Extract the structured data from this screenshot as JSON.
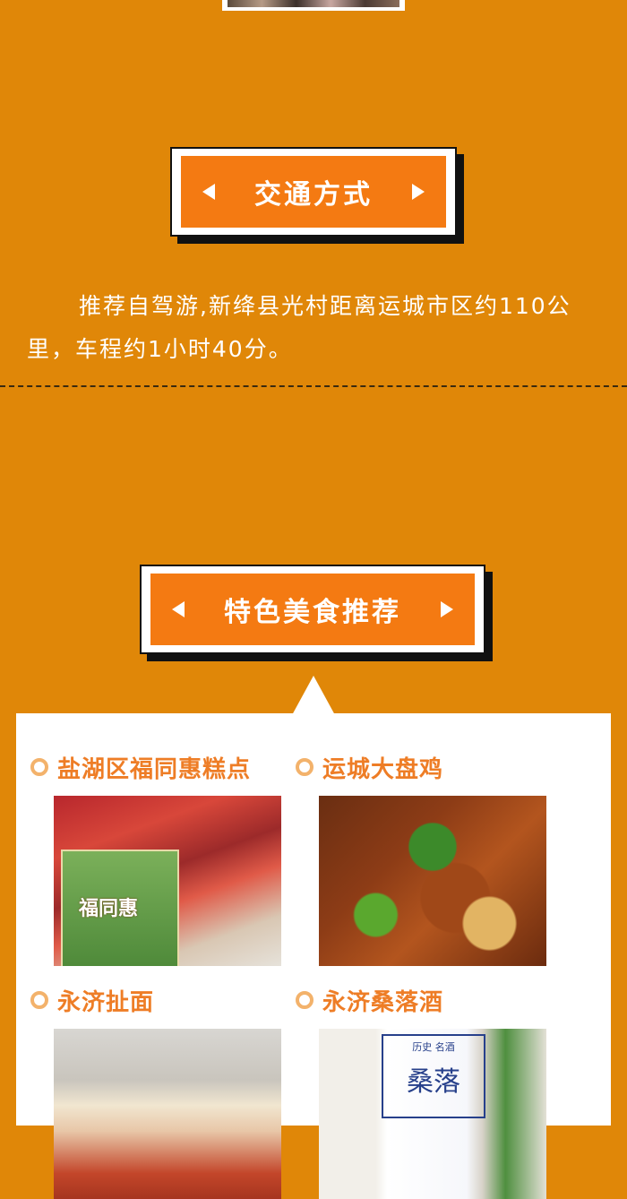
{
  "transport": {
    "banner_title": "交通方式",
    "paragraph": "推荐自驾游,新绛县光村距离运城市区约110公里，车程约1小时40分。"
  },
  "food": {
    "banner_title": "特色美食推荐",
    "items": [
      {
        "name": "盐湖区福同惠糕点",
        "photo_text": "福同惠"
      },
      {
        "name": "运城大盘鸡"
      },
      {
        "name": "永济扯面"
      },
      {
        "name": "永济桑落酒",
        "photo_text_top": "历史 名酒",
        "photo_text_big": "桑落"
      }
    ]
  },
  "colors": {
    "page_background": "#E08708",
    "banner_fill": "#F47A12",
    "item_title": "#EE7D26"
  },
  "icons": [
    "arrow-left-icon",
    "arrow-right-icon",
    "bullet-circle-icon"
  ]
}
